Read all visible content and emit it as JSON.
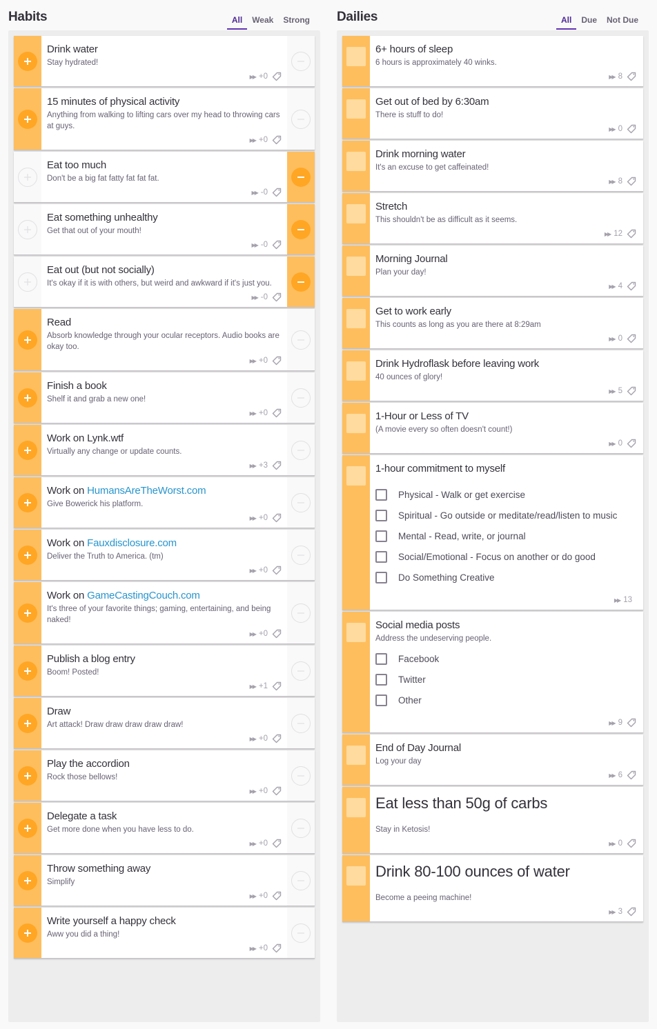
{
  "habits": {
    "title": "Habits",
    "filters": [
      {
        "label": "All",
        "active": true
      },
      {
        "label": "Weak",
        "active": false
      },
      {
        "label": "Strong",
        "active": false
      }
    ],
    "items": [
      {
        "title": "Drink water",
        "notes": "Stay hydrated!",
        "value": "+0",
        "positive_active": true,
        "negative_active": false
      },
      {
        "title": "15 minutes of physical activity",
        "notes": "Anything from walking to lifting cars over my head to throwing cars at guys.",
        "value": "+0",
        "positive_active": true,
        "negative_active": false
      },
      {
        "title": "Eat too much",
        "notes": "Don't be a big fat fatty fat fat fat.",
        "value": "-0",
        "positive_active": false,
        "negative_active": true
      },
      {
        "title": "Eat something unhealthy",
        "notes": "Get that out of your mouth!",
        "value": "-0",
        "positive_active": false,
        "negative_active": true
      },
      {
        "title": "Eat out (but not socially)",
        "notes": "It's okay if it is with others, but weird and awkward if it's just you.",
        "value": "-0",
        "positive_active": false,
        "negative_active": true
      },
      {
        "title": "Read",
        "notes": "Absorb knowledge through your ocular receptors. Audio books are okay too.",
        "value": "+0",
        "positive_active": true,
        "negative_active": false
      },
      {
        "title": "Finish a book",
        "notes": "Shelf it and grab a new one!",
        "value": "+0",
        "positive_active": true,
        "negative_active": false
      },
      {
        "title": "Work on Lynk.wtf",
        "notes": "Virtually any change or update counts.",
        "value": "+3",
        "positive_active": true,
        "negative_active": false
      },
      {
        "title_prefix": "Work on ",
        "title_link": "HumansAreTheWorst.com",
        "notes": "Give Bowerick his platform.",
        "value": "+0",
        "positive_active": true,
        "negative_active": false
      },
      {
        "title_prefix": "Work on ",
        "title_link": "Fauxdisclosure.com",
        "notes": "Deliver the Truth to America. (tm)",
        "value": "+0",
        "positive_active": true,
        "negative_active": false
      },
      {
        "title_prefix": "Work on ",
        "title_link": "GameCastingCouch.com",
        "notes": "It's three of your favorite things; gaming, entertaining, and being naked!",
        "value": "+0",
        "positive_active": true,
        "negative_active": false
      },
      {
        "title": "Publish a blog entry",
        "notes": "Boom! Posted!",
        "value": "+1",
        "positive_active": true,
        "negative_active": false
      },
      {
        "title": "Draw",
        "notes": "Art attack! Draw draw draw draw draw!",
        "value": "+0",
        "positive_active": true,
        "negative_active": false
      },
      {
        "title": "Play the accordion",
        "notes": "Rock those bellows!",
        "value": "+0",
        "positive_active": true,
        "negative_active": false
      },
      {
        "title": "Delegate a task",
        "notes": "Get more done when you have less to do.",
        "value": "+0",
        "positive_active": true,
        "negative_active": false
      },
      {
        "title": "Throw something away",
        "notes": "Simplify",
        "value": "+0",
        "positive_active": true,
        "negative_active": false
      },
      {
        "title": "Write yourself a happy check",
        "notes": "Aww you did a thing!",
        "value": "+0",
        "positive_active": true,
        "negative_active": false
      }
    ]
  },
  "dailies": {
    "title": "Dailies",
    "filters": [
      {
        "label": "All",
        "active": true
      },
      {
        "label": "Due",
        "active": false
      },
      {
        "label": "Not Due",
        "active": false
      }
    ],
    "items": [
      {
        "title": "6+ hours of sleep",
        "notes": "6 hours is approximately 40 winks.",
        "streak": "8"
      },
      {
        "title": "Get out of bed by 6:30am",
        "notes": "There is stuff to do!",
        "streak": "0"
      },
      {
        "title": "Drink morning water",
        "notes": "It's an excuse to get caffeinated!",
        "streak": "8"
      },
      {
        "title": "Stretch",
        "notes": "This shouldn't be as difficult as it seems.",
        "streak": "12"
      },
      {
        "title": "Morning Journal",
        "notes": "Plan your day!",
        "streak": "4"
      },
      {
        "title": "Get to work early",
        "notes": "This counts as long as you are there at 8:29am",
        "streak": "0"
      },
      {
        "title": "Drink Hydroflask before leaving work",
        "notes": "40 ounces of glory!",
        "streak": "5"
      },
      {
        "title": "1-Hour or Less of TV",
        "notes": "(A movie every so often doesn't count!)",
        "streak": "0"
      },
      {
        "title": "1-hour commitment to myself",
        "notes": "",
        "streak": "13",
        "no_tag": true,
        "checklist": [
          "Physical - Walk or get exercise",
          "Spiritual - Go outside or meditate/read/listen to music",
          "Mental - Read, write, or journal",
          "Social/Emotional - Focus on another or do good",
          "Do Something Creative"
        ]
      },
      {
        "title": "Social media posts",
        "notes": "Address the undeserving people.",
        "streak": "9",
        "checklist": [
          "Facebook",
          "Twitter",
          "Other"
        ]
      },
      {
        "title": "End of Day Journal",
        "notes": "Log your day",
        "streak": "6"
      },
      {
        "title": "Eat less than 50g of carbs",
        "notes": "Stay in Ketosis!",
        "streak": "0",
        "big": true
      },
      {
        "title": "Drink 80-100 ounces of water",
        "notes": "Become a peeing machine!",
        "streak": "3",
        "big": true
      }
    ]
  },
  "icons": {
    "plus": "plus-icon",
    "minus": "minus-icon",
    "streak": "fast-forward-icon",
    "tag": "tag-icon"
  },
  "colors": {
    "accent_orange": "#ffbe5d",
    "button_orange": "#ffa624",
    "checkbox_light": "#ffdb9f",
    "link_blue": "#2995cd",
    "active_filter": "#4f2a93"
  }
}
